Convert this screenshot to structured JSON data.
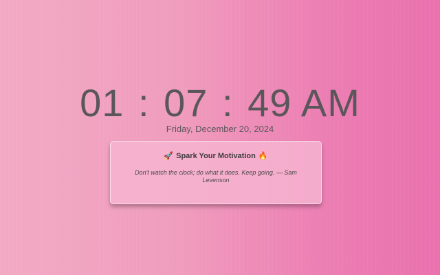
{
  "clock": {
    "hours": "01",
    "minutes": "07",
    "seconds": "49",
    "separator": ":",
    "period": "AM"
  },
  "date": "Friday, December 20, 2024",
  "card": {
    "title": "Spark Your Motivation",
    "leading_icon": "rocket-icon",
    "trailing_icon": "fire-icon",
    "quote": "Don't watch the clock; do what it does. Keep going. — Sam Levenson"
  },
  "colors": {
    "background_left": "#f2aac3",
    "background_right": "#ea71ad",
    "text": "#5a565a",
    "card_bg": "#f6b4d0"
  }
}
